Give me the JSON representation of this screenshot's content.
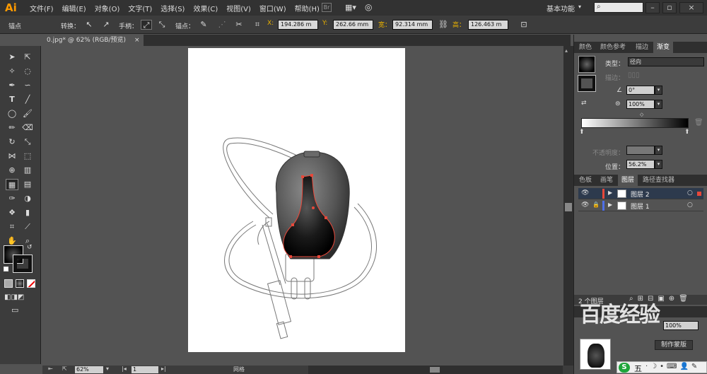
{
  "app": {
    "logo": "Ai"
  },
  "menu": [
    "文件(F)",
    "编辑(E)",
    "对象(O)",
    "文字(T)",
    "选择(S)",
    "效果(C)",
    "视图(V)",
    "窗口(W)",
    "帮助(H)"
  ],
  "workspace": "基本功能",
  "control": {
    "anchor_label": "锚点",
    "convert_label": "转换：",
    "handle_label": "手柄：",
    "anchor2_label": "锚点：",
    "x_key": "X:",
    "x_value": "194.286 m",
    "y_key": "Y:",
    "y_value": "262.66 mm",
    "w_key": "宽：",
    "w_value": "92.314 mm",
    "h_key": "高：",
    "h_value": "126.463 m"
  },
  "document_tab": {
    "title": "0.jpg* @ 62% (RGB/预览)",
    "close": "×"
  },
  "status": {
    "zoom": "62%",
    "page": "1",
    "mode": "网格"
  },
  "gradient_panel": {
    "tabs": [
      "颜色",
      "颜色参考",
      "描边",
      "渐变"
    ],
    "active_tab": "渐变",
    "type_label": "类型：",
    "type_value": "径向",
    "stroke_label": "描边：",
    "angle_value": "0°",
    "aspect_value": "100%",
    "opacity_label": "不透明度：",
    "location_label": "位置：",
    "location_value": "56.2%"
  },
  "layers_panel": {
    "tabs": [
      "色板",
      "画笔",
      "图层",
      "路径查找器"
    ],
    "active_tab": "图层",
    "layers": [
      {
        "name": "图层 2",
        "color": "#e8483a"
      },
      {
        "name": "图层 1",
        "color": "#4f6fe8"
      }
    ],
    "count": "2 个图层"
  },
  "navigator_panel": {
    "zoom_value": "100%",
    "button_label": "制作蒙版"
  },
  "watermark": "百度经验",
  "ime": "五",
  "colors": {
    "menubar": "#323232",
    "panel": "#3c3c3c",
    "canvas": "#535353",
    "accent": "#ff9a00",
    "selection": "#e8483a"
  }
}
